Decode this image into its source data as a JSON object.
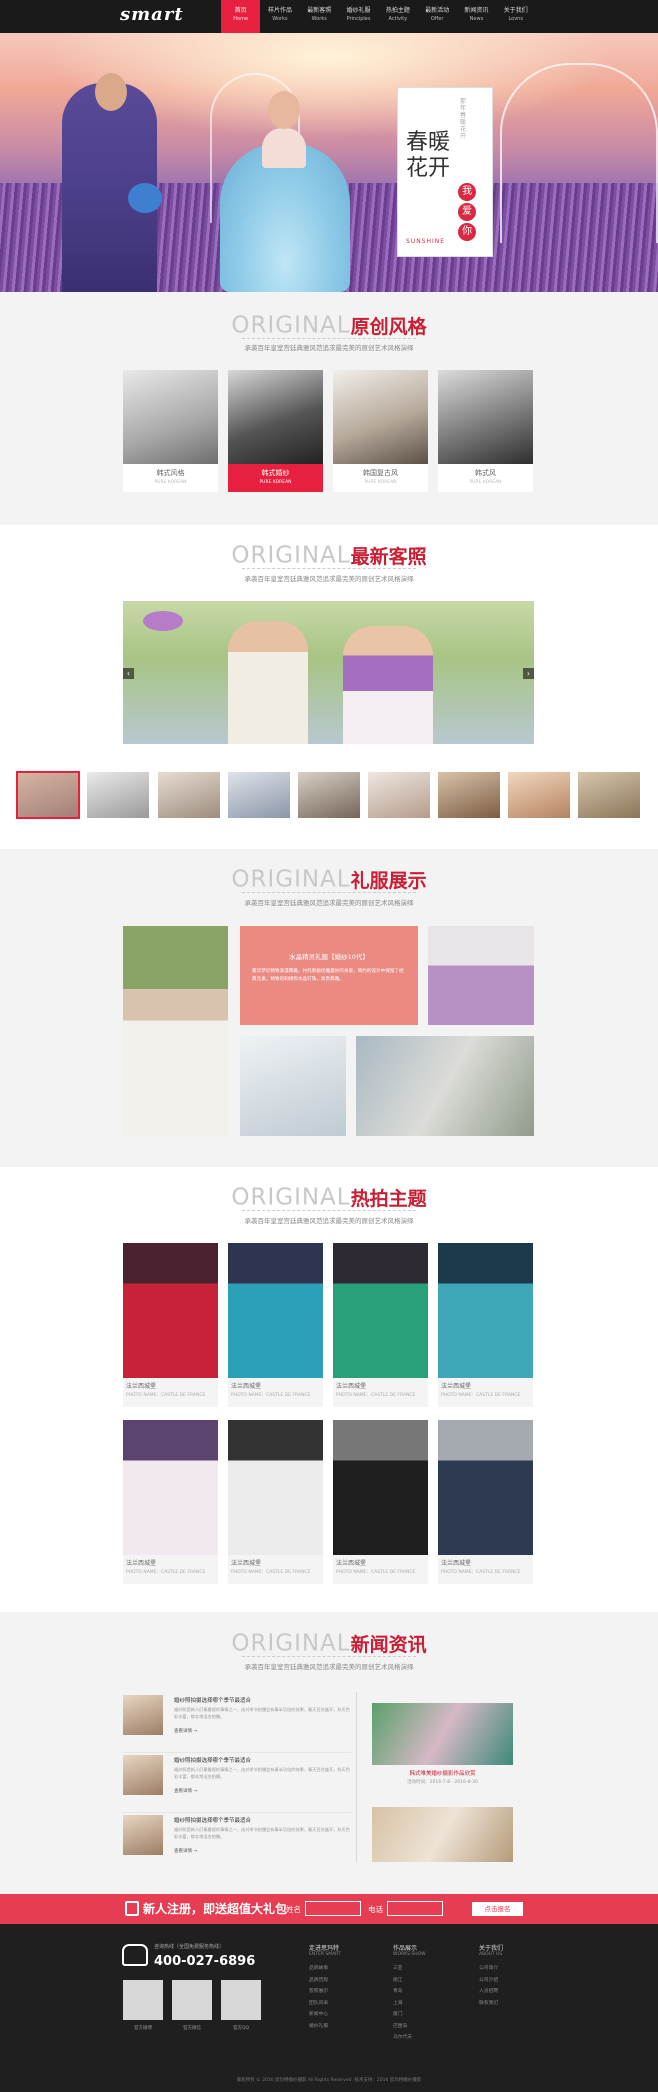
{
  "header": {
    "logo": "smart",
    "nav": [
      {
        "zh": "首页",
        "en": "Home"
      },
      {
        "zh": "样片作品",
        "en": "Works"
      },
      {
        "zh": "最新客照",
        "en": "Works"
      },
      {
        "zh": "婚纱礼服",
        "en": "Principles"
      },
      {
        "zh": "热拍主题",
        "en": "Activity"
      },
      {
        "zh": "最新活动",
        "en": "Offer"
      },
      {
        "zh": "新闻资讯",
        "en": "News"
      },
      {
        "zh": "关于我们",
        "en": "Lovns"
      }
    ]
  },
  "hero": {
    "title": "春暖花开",
    "dots": [
      "我",
      "爱",
      "你"
    ],
    "en": "SUNSHINE",
    "vertical": "那年春暖花开"
  },
  "sections": {
    "original": {
      "en": "ORIGINAL",
      "zh": "原创风格",
      "sub": "承袭百年皇室宫廷典雅风范追求最完美的原创艺术风格演绎"
    },
    "latest": {
      "en": "ORIGINAL",
      "zh": "最新客照",
      "sub": "承袭百年皇室宫廷典雅风范追求最完美的原创艺术风格演绎"
    },
    "dress": {
      "en": "ORIGINAL",
      "zh": "礼服展示",
      "sub": "承袭百年皇室宫廷典雅风范追求最完美的原创艺术风格演绎"
    },
    "theme": {
      "en": "ORIGINAL",
      "zh": "热拍主题",
      "sub": "承袭百年皇室宫廷典雅风范追求最完美的原创艺术风格演绎"
    },
    "news": {
      "en": "ORIGINAL",
      "zh": "新闻资讯",
      "sub": "承袭百年皇室宫廷典雅风范追求最完美的原创艺术风格演绎"
    }
  },
  "style_cards": [
    {
      "cap": "韩式风格",
      "sub": "PURE KOREAN"
    },
    {
      "cap": "韩式婚纱",
      "sub": "PURE KOREAN"
    },
    {
      "cap": "韩国复古风",
      "sub": "PURE KOREAN"
    },
    {
      "cap": "韩式风",
      "sub": "PURE KOREAN"
    }
  ],
  "dress_box": {
    "title": "水晶精灵礼服【婚纱10代】",
    "desc": "繁华梦幻精致浪漫典雅，衬托新娘优雅曼妙的身姿，简约的设计中保留了经典元素，精致的刺绣和水晶钉珠，高贵典雅。"
  },
  "theme_cards": [
    {
      "name": "法兰西城堡",
      "sub": "PHOTO NAME：CASTLE DE FRANCE"
    },
    {
      "name": "法兰西城堡",
      "sub": "PHOTO NAME：CASTLE DE FRANCE"
    },
    {
      "name": "法兰西城堡",
      "sub": "PHOTO NAME：CASTLE DE FRANCE"
    },
    {
      "name": "法兰西城堡",
      "sub": "PHOTO NAME：CASTLE DE FRANCE"
    },
    {
      "name": "法兰西城堡",
      "sub": "PHOTO NAME：CASTLE DE FRANCE"
    },
    {
      "name": "法兰西城堡",
      "sub": "PHOTO NAME：CASTLE DE FRANCE"
    },
    {
      "name": "法兰西城堡",
      "sub": "PHOTO NAME：CASTLE DE FRANCE"
    },
    {
      "name": "法兰西城堡",
      "sub": "PHOTO NAME：CASTLE DE FRANCE"
    }
  ],
  "news": [
    {
      "title": "婚纱照拍摄选择哪个季节最适合",
      "desc": "婚纱照是新人们最重视的事情之一，选对季节拍摄会有事半功倍的效果，春天百花盛开，秋天色彩丰富，都非常适合拍摄。",
      "more": "查看详情 →"
    },
    {
      "title": "婚纱照拍摄选择哪个季节最适合",
      "desc": "婚纱照是新人们最重视的事情之一，选对季节拍摄会有事半功倍的效果，春天百花盛开，秋天色彩丰富，都非常适合拍摄。",
      "more": "查看详情 →"
    },
    {
      "title": "婚纱照拍摄选择哪个季节最适合",
      "desc": "婚纱照是新人们最重视的事情之一，选对季节拍摄会有事半功倍的效果，春天百花盛开，秋天色彩丰富，都非常适合拍摄。",
      "more": "查看详情 →"
    }
  ],
  "news_right": {
    "title": "韩式唯美婚纱摄影作品欣赏",
    "date": "活动时间：2016-7-8 - 2016-8-30"
  },
  "register": {
    "title": "新人注册，即送超值大礼包",
    "name_label": "姓名",
    "phone_label": "电话",
    "button": "点击报名"
  },
  "footer": {
    "tel_label": "咨询热线（全国免费服务热线）",
    "tel": "400-027-6896",
    "qr": [
      "官方微博",
      "官方微信",
      "官方QQ"
    ],
    "cols": [
      {
        "h": "走进思玛特",
        "he": "ENTER SMART",
        "links": [
          "品牌故事",
          "品牌历程",
          "客照展示",
          "团队风采",
          "新闻中心",
          "婚纱礼服"
        ]
      },
      {
        "h": "作品展示",
        "he": "WORKS SHOW",
        "links": [
          "三亚",
          "丽江",
          "青岛",
          "上海",
          "厦门",
          "巴厘岛",
          "马尔代夫"
        ]
      },
      {
        "h": "关于我们",
        "he": "ABOUT US",
        "links": [
          "公司简介",
          "公司介绍",
          "人员招聘",
          "联系我们"
        ]
      }
    ],
    "copyright": "版权所有 © 2016 思玛特婚纱摄影 All Rights Reserved. 技术支持：2016 思玛特婚纱摄影"
  }
}
